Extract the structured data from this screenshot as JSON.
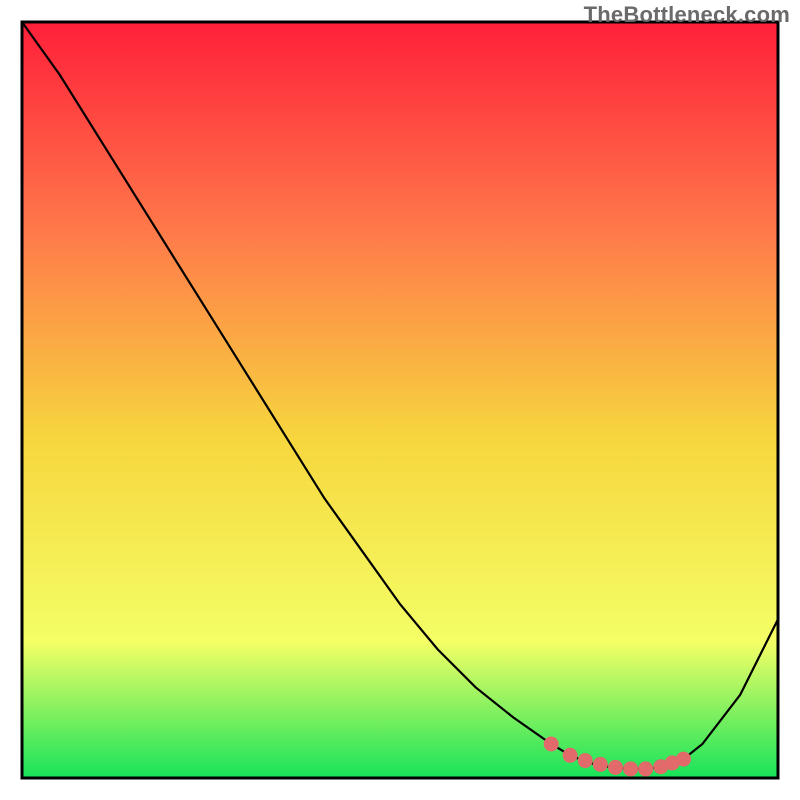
{
  "watermark": "TheBottleneck.com",
  "colors": {
    "gradient_top": "#ff1f3a",
    "gradient_upper_mid": "#ff7a4a",
    "gradient_mid": "#f7d63e",
    "gradient_lower_mid": "#f4ff66",
    "gradient_bottom": "#16e35a",
    "curve": "#000000",
    "marker": "#e26a6a",
    "frame": "#000000"
  },
  "chart_data": {
    "type": "line",
    "title": "",
    "xlabel": "",
    "ylabel": "",
    "x": [
      0.0,
      0.05,
      0.1,
      0.15,
      0.2,
      0.25,
      0.3,
      0.35,
      0.4,
      0.45,
      0.5,
      0.55,
      0.6,
      0.65,
      0.7,
      0.725,
      0.75,
      0.775,
      0.8,
      0.825,
      0.85,
      0.875,
      0.9,
      0.95,
      1.0
    ],
    "values": [
      1.0,
      0.93,
      0.85,
      0.77,
      0.69,
      0.61,
      0.53,
      0.45,
      0.37,
      0.3,
      0.23,
      0.17,
      0.12,
      0.08,
      0.045,
      0.03,
      0.02,
      0.015,
      0.012,
      0.012,
      0.015,
      0.025,
      0.045,
      0.11,
      0.21
    ],
    "ylim": [
      0,
      1
    ],
    "xlim": [
      0,
      1
    ],
    "highlight_region": {
      "x_start": 0.7,
      "x_end": 0.875
    },
    "highlight_points_x": [
      0.7,
      0.725,
      0.745,
      0.765,
      0.785,
      0.805,
      0.825,
      0.845,
      0.86,
      0.875
    ],
    "highlight_points_y": [
      0.045,
      0.03,
      0.023,
      0.018,
      0.014,
      0.012,
      0.012,
      0.015,
      0.02,
      0.025
    ]
  }
}
